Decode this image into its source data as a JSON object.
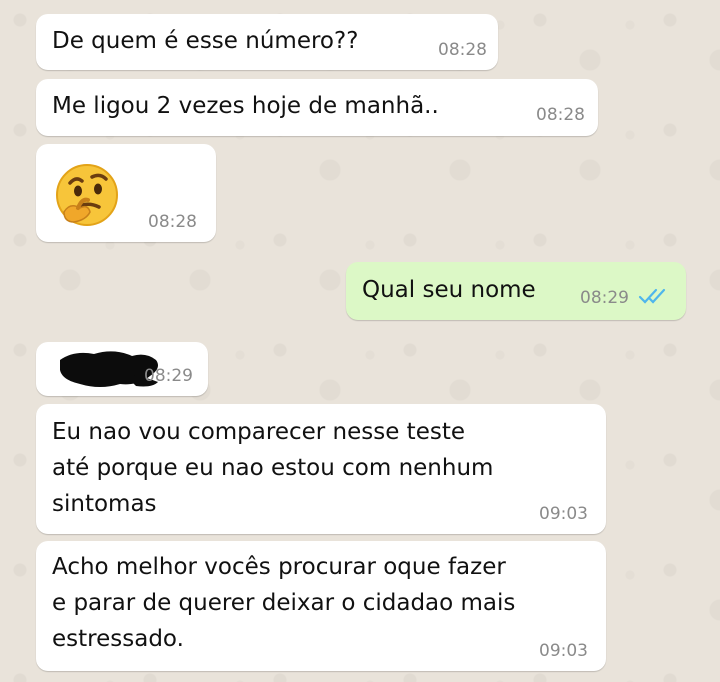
{
  "chat": {
    "messages": [
      {
        "text": "De quem é esse número??",
        "time": "08:28"
      },
      {
        "text": "Me ligou 2 vezes hoje de manhã..",
        "time": "08:28"
      },
      {
        "emoji": "thinking-face",
        "time": "08:28"
      },
      {
        "text": "Qual seu nome",
        "time": "08:29",
        "status": "read-double-check"
      },
      {
        "redacted": true,
        "time": "08:29"
      },
      {
        "text": "Eu nao vou comparecer nesse teste\naté porque eu nao estou com nenhum\nsintomas",
        "time": "09:03"
      },
      {
        "text": "Acho melhor vocês procurar oque fazer\ne parar de querer deixar o cidadao mais\nestressado.",
        "time": "09:03"
      }
    ]
  },
  "colors": {
    "background": "#e9e3da",
    "incoming_bubble": "#ffffff",
    "outgoing_bubble": "#dcf8c6",
    "read_ticks": "#4fb6ec",
    "timestamp": "#8a8a8a"
  }
}
